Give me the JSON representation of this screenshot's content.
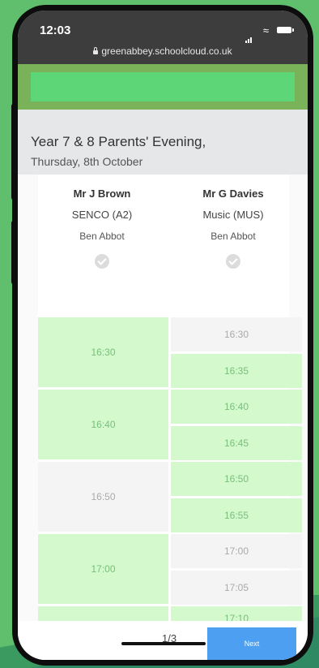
{
  "status": {
    "time": "12:03",
    "url": "greenabbey.schoolcloud.co.uk"
  },
  "event": {
    "title": "Year 7 & 8 Parents' Evening,",
    "date": "Thursday, 8th October"
  },
  "teachers": [
    {
      "name": "Mr J Brown",
      "subject": "SENCO (A2)",
      "student": "Ben Abbot"
    },
    {
      "name": "Mr G Davies",
      "subject": "Music (MUS)",
      "student": "Ben Abbot"
    }
  ],
  "slots": {
    "col1": [
      {
        "time": "16:30",
        "available": true
      },
      {
        "time": "16:40",
        "available": true
      },
      {
        "time": "16:50",
        "available": false
      },
      {
        "time": "17:00",
        "available": true
      },
      {
        "time": "",
        "available": true
      }
    ],
    "col2": [
      {
        "time": "16:30",
        "available": false
      },
      {
        "time": "16:35",
        "available": true
      },
      {
        "time": "16:40",
        "available": true
      },
      {
        "time": "16:45",
        "available": true
      },
      {
        "time": "16:50",
        "available": true
      },
      {
        "time": "16:55",
        "available": true
      },
      {
        "time": "17:00",
        "available": false
      },
      {
        "time": "17:05",
        "available": false
      },
      {
        "time": "17:10",
        "available": true
      }
    ]
  },
  "pagination": {
    "page": "1/3",
    "next_label": "Next"
  },
  "colors": {
    "available": "#d3f9cc",
    "unavailable": "#f4f4f4",
    "accent": "#4c9ff1",
    "banner": "#79b258"
  }
}
